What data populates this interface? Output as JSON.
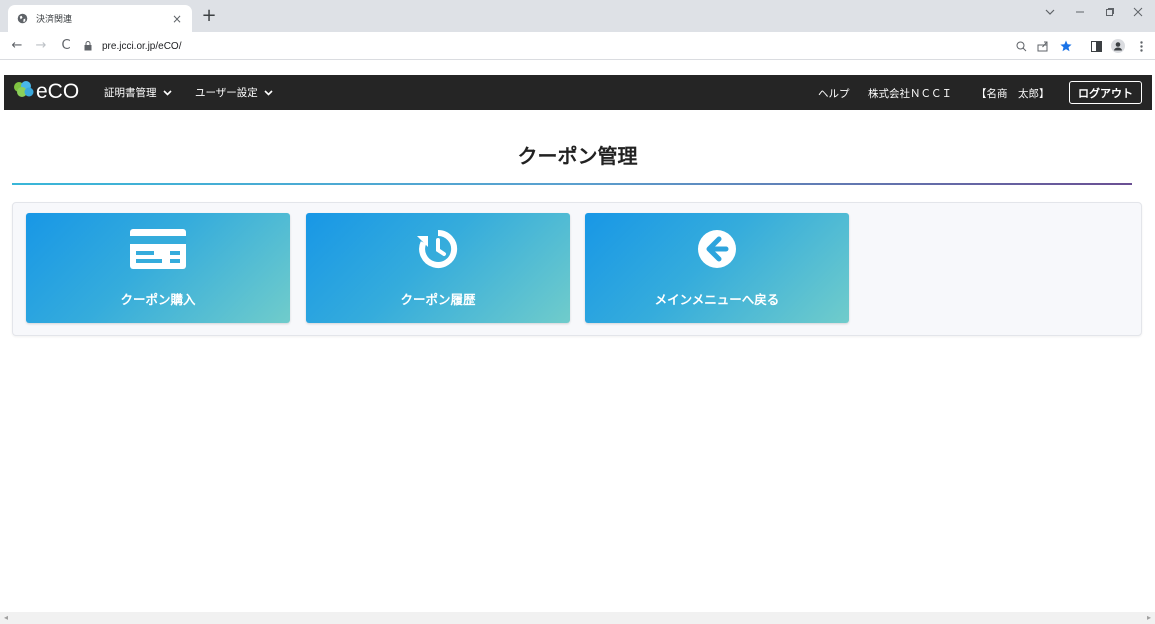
{
  "browser": {
    "tab_title": "決済関連",
    "url": "pre.jcci.or.jp/eCO/"
  },
  "app": {
    "logo_text": "eCO",
    "menu": [
      {
        "label": "証明書管理"
      },
      {
        "label": "ユーザー設定"
      }
    ],
    "help": "ヘルプ",
    "company": "株式会社ＮＣＣＩ",
    "user": "【名商　太郎】",
    "logout": "ログアウト"
  },
  "page": {
    "title": "クーポン管理"
  },
  "cards": [
    {
      "label": "クーポン購入",
      "icon": "card-icon"
    },
    {
      "label": "クーポン履歴",
      "icon": "history-icon"
    },
    {
      "label": "メインメニューへ戻る",
      "icon": "arrow-left-circle-icon"
    }
  ],
  "colors": {
    "header_bg": "#252525",
    "card_gradient_start": "#1897e6",
    "card_gradient_end": "#70cccb",
    "accent_rule": "#39b6d8"
  }
}
